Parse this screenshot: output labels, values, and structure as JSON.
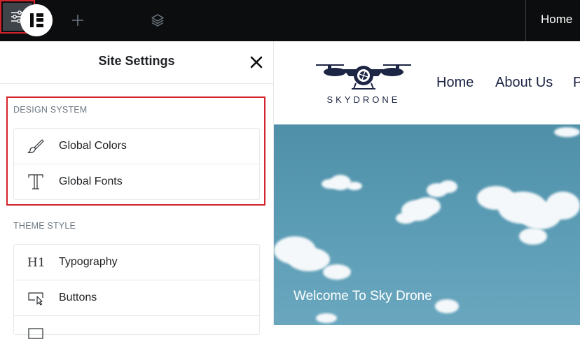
{
  "topbar": {
    "logo_icon": "elementor-logo-icon",
    "add_icon": "plus-icon",
    "settings_icon": "sliders-icon",
    "layers_icon": "layers-icon",
    "preview_nav_home": "Home",
    "highlight_color": "#d3232d"
  },
  "panel": {
    "title": "Site Settings",
    "close_icon": "close-icon",
    "design_system": {
      "label": "DESIGN SYSTEM",
      "items": [
        {
          "label": "Global Colors",
          "icon": "brush-icon"
        },
        {
          "label": "Global Fonts",
          "icon": "font-t-icon"
        }
      ]
    },
    "theme_style": {
      "label": "THEME STYLE",
      "items": [
        {
          "label": "Typography",
          "icon": "h1-icon"
        },
        {
          "label": "Buttons",
          "icon": "button-pointer-icon"
        },
        {
          "label": "",
          "icon": "image-icon"
        }
      ]
    }
  },
  "preview": {
    "brand": "SKYDRONE",
    "brand_icon": "drone-logo-icon",
    "nav": [
      "Home",
      "About Us",
      "P"
    ],
    "hero_text": "Welcome To Sky Drone",
    "brand_color": "#1c2544"
  }
}
